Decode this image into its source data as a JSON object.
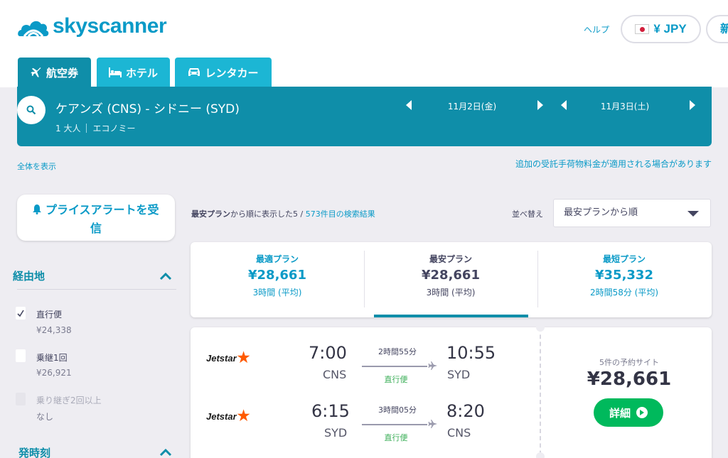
{
  "header": {
    "logo_text": "skyscanner",
    "help_label": "ヘルプ",
    "currency_label": "¥ JPY",
    "partial_button_label": "新"
  },
  "tabs": [
    {
      "label": "航空券",
      "icon": "plane-icon",
      "active": true
    },
    {
      "label": "ホテル",
      "icon": "bed-icon",
      "active": false
    },
    {
      "label": "レンタカー",
      "icon": "car-icon",
      "active": false
    }
  ],
  "search": {
    "route": "ケアンズ (CNS) - シドニー (SYD)",
    "passengers": "1 大人",
    "cabin": "エコノミー",
    "depart_date": "11月2日(金)",
    "return_date": "11月3日(土)"
  },
  "links": {
    "show_all": "全体を表示",
    "baggage_notice": "追加の受託手荷物料金が適用される場合があります"
  },
  "sidebar": {
    "price_alert_line1": "プライスアラートを受",
    "price_alert_line2": "信",
    "stops_heading": "経由地",
    "stops": [
      {
        "label": "直行便",
        "price": "¥24,338",
        "checked": true,
        "disabled": false
      },
      {
        "label": "乗継1回",
        "price": "¥26,921",
        "checked": false,
        "disabled": false
      },
      {
        "label": "乗り継ぎ2回以上",
        "price": "なし",
        "checked": false,
        "disabled": true
      }
    ],
    "departure_heading": "発時刻"
  },
  "results": {
    "count_prefix": "最安プラン",
    "count_middle": "から順に表示した5 / ",
    "count_link": "573件目の検索結果",
    "sort_label": "並べ替え",
    "sort_value": "最安プランから順"
  },
  "plans": [
    {
      "name": "最適プラン",
      "price": "¥28,661",
      "duration": "3時間 (平均)",
      "selected": false
    },
    {
      "name": "最安プラン",
      "price": "¥28,661",
      "duration": "3時間 (平均)",
      "selected": true
    },
    {
      "name": "最短プラン",
      "price": "¥35,332",
      "duration": "2時間58分 (平均)",
      "selected": false
    }
  ],
  "itinerary": {
    "legs": [
      {
        "carrier": "Jetstar",
        "dep_time": "7:00",
        "dep_airport": "CNS",
        "duration": "2時間55分",
        "stops": "直行便",
        "arr_time": "10:55",
        "arr_airport": "SYD"
      },
      {
        "carrier": "Jetstar",
        "dep_time": "6:15",
        "dep_airport": "SYD",
        "duration": "3時間05分",
        "stops": "直行便",
        "arr_time": "8:20",
        "arr_airport": "CNS"
      }
    ],
    "booking_sites": "5件の予約サイト",
    "price": "¥28,661",
    "detail_label": "詳細"
  },
  "colors": {
    "brand": "#0a9ac7",
    "bar": "#0f8ea9",
    "tab": "#1cb6d4",
    "cta": "#00b95c",
    "jetstar": "#ff5a00"
  }
}
